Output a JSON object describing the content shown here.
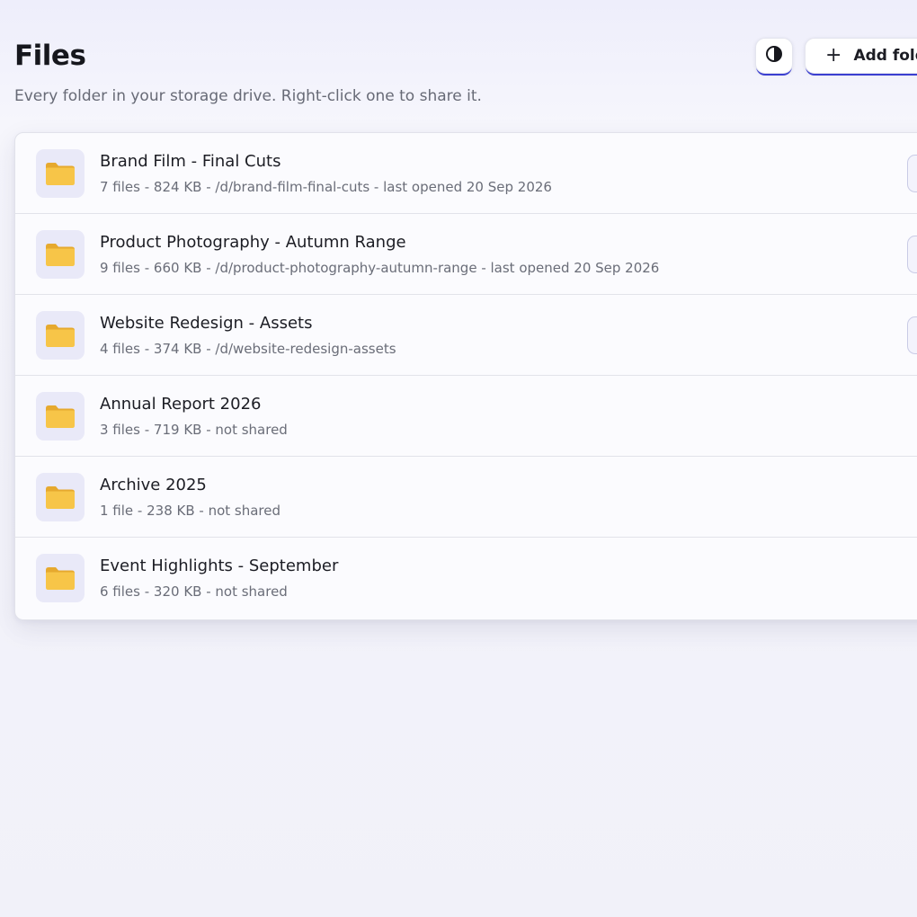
{
  "header": {
    "title": "Files",
    "subtitle": "Every folder in your storage drive. Right-click one to share it.",
    "theme_toggle_icon": "contrast-icon",
    "add_button_icon": "plus-icon",
    "add_button_label": "Add folder"
  },
  "colors": {
    "accent": "#3b3fd0",
    "folder": "#f5be3f",
    "folder_tile": "#e9e9f8"
  },
  "folders": [
    {
      "name": "Brand Film - Final Cuts",
      "meta": "7 files - 824 KB - /d/brand-film-final-cuts - last opened 20 Sep 2026",
      "icon": "folder-icon",
      "shared": true
    },
    {
      "name": "Product Photography - Autumn Range",
      "meta": "9 files - 660 KB - /d/product-photography-autumn-range - last opened 20 Sep 2026",
      "icon": "folder-icon",
      "shared": true
    },
    {
      "name": "Website Redesign - Assets",
      "meta": "4 files - 374 KB - /d/website-redesign-assets",
      "icon": "folder-icon",
      "shared": true
    },
    {
      "name": "Annual Report 2026",
      "meta": "3 files - 719 KB - not shared",
      "icon": "folder-icon",
      "shared": false
    },
    {
      "name": "Archive 2025",
      "meta": "1 file - 238 KB - not shared",
      "icon": "folder-icon",
      "shared": false
    },
    {
      "name": "Event Highlights - September",
      "meta": "6 files - 320 KB - not shared",
      "icon": "folder-icon",
      "shared": false
    }
  ]
}
